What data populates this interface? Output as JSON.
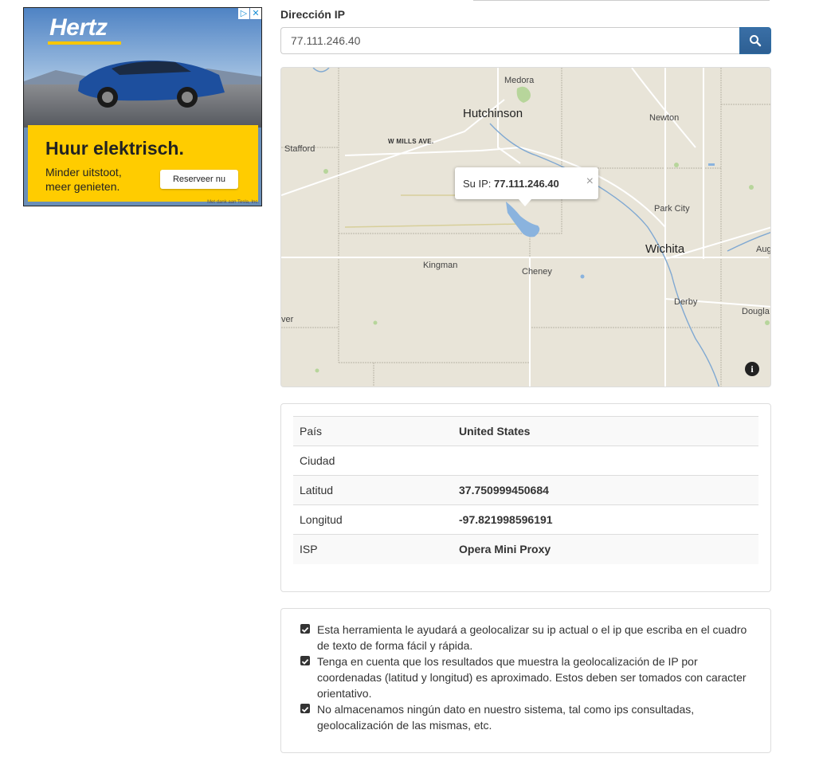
{
  "ad": {
    "logo": "Hertz",
    "headline": "Huur elektrisch.",
    "subtext": "Minder uitstoot, meer genieten.",
    "cta": "Reserveer nu",
    "credit": "Met dank aan Tesla, Inc.",
    "badge_info": "▷",
    "badge_close": "✕",
    "brand_yellow": "#ffcc00"
  },
  "form": {
    "label": "Dirección IP",
    "ip_value": "77.111.246.40",
    "search_icon": "search-icon",
    "button_color": "#337ab7"
  },
  "map": {
    "popup_prefix": "Su IP:",
    "popup_ip": "77.111.246.40",
    "popup_close": "×",
    "info_icon": "i",
    "labels": {
      "medora": "Medora",
      "hutchinson": "Hutchinson",
      "newton": "Newton",
      "stafford": "Stafford",
      "w_mills": "W MILLS AVE.",
      "park_city": "Park City",
      "wichita": "Wichita",
      "aug": "Aug",
      "kingman": "Kingman",
      "cheney": "Cheney",
      "derby": "Derby",
      "dougla": "Dougla",
      "ver": "ver"
    }
  },
  "info": {
    "rows": [
      {
        "key": "País",
        "value": "United States"
      },
      {
        "key": "Ciudad",
        "value": ""
      },
      {
        "key": "Latitud",
        "value": "37.750999450684"
      },
      {
        "key": "Longitud",
        "value": "-97.821998596191"
      },
      {
        "key": "ISP",
        "value": "Opera Mini Proxy"
      }
    ]
  },
  "notes": [
    "Esta herramienta le ayudará a geolocalizar su ip actual o el ip que escriba en el cuadro de texto de forma fácil y rápida.",
    "Tenga en cuenta que los resultados que muestra la geolocalización de IP por coordenadas (latitud y longitud) es aproximado. Estos deben ser tomados con caracter orientativo.",
    "No almacenamos ningún dato en nuestro sistema, tal como ips consultadas, geolocalización de las mismas, etc."
  ]
}
